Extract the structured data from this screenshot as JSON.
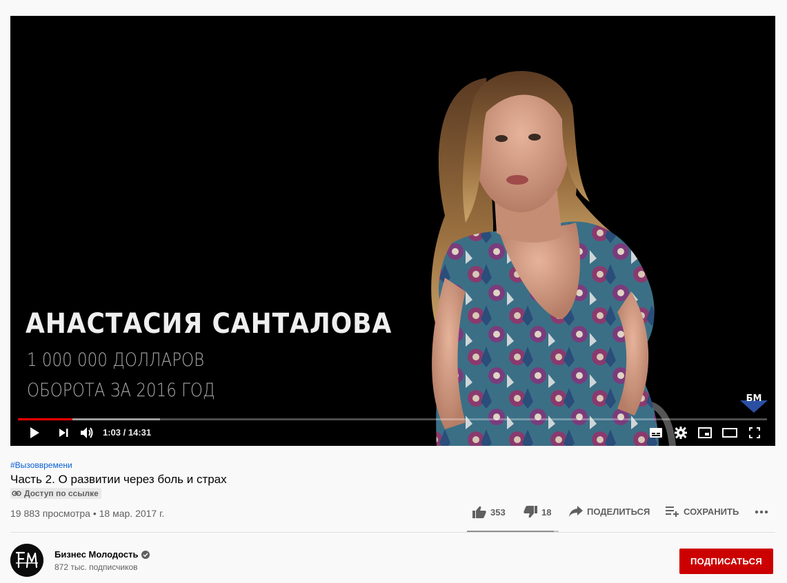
{
  "player": {
    "overlay_name": "АНАСТАСИЯ САНТАЛОВА",
    "overlay_line1": "1 000 000 ДОЛЛАРОВ",
    "overlay_line2": "ОБОРОТА ЗА 2016 ГОД",
    "watermark": "БМ",
    "time": "1:03 / 14:31",
    "played_fraction": 0.073,
    "loaded_fraction": 0.19,
    "icons": [
      "play-icon",
      "next-icon",
      "volume-icon",
      "subtitles-icon",
      "settings-icon",
      "miniplayer-icon",
      "theater-icon",
      "fullscreen-icon"
    ]
  },
  "video": {
    "hashtag": "#Вызоввремени",
    "title": "Часть 2. О развитии через боль и страх",
    "access_label": "Доступ по ссылке",
    "views_date": "19 883 просмотра • 18 мар. 2017 г."
  },
  "actions": {
    "likes": "353",
    "dislikes": "18",
    "share": "ПОДЕЛИТЬСЯ",
    "save": "СОХРАНИТЬ",
    "like_ratio": 0.95
  },
  "channel": {
    "name": "Бизнес Молодость",
    "subscribers": "872 тыс. подписчиков",
    "subscribe_label": "ПОДПИСАТЬСЯ"
  },
  "colors": {
    "accent_red": "#cc0000",
    "progress_red": "#ff0000",
    "link_blue": "#065fd4",
    "watermark_blue": "#2b4fa3"
  }
}
